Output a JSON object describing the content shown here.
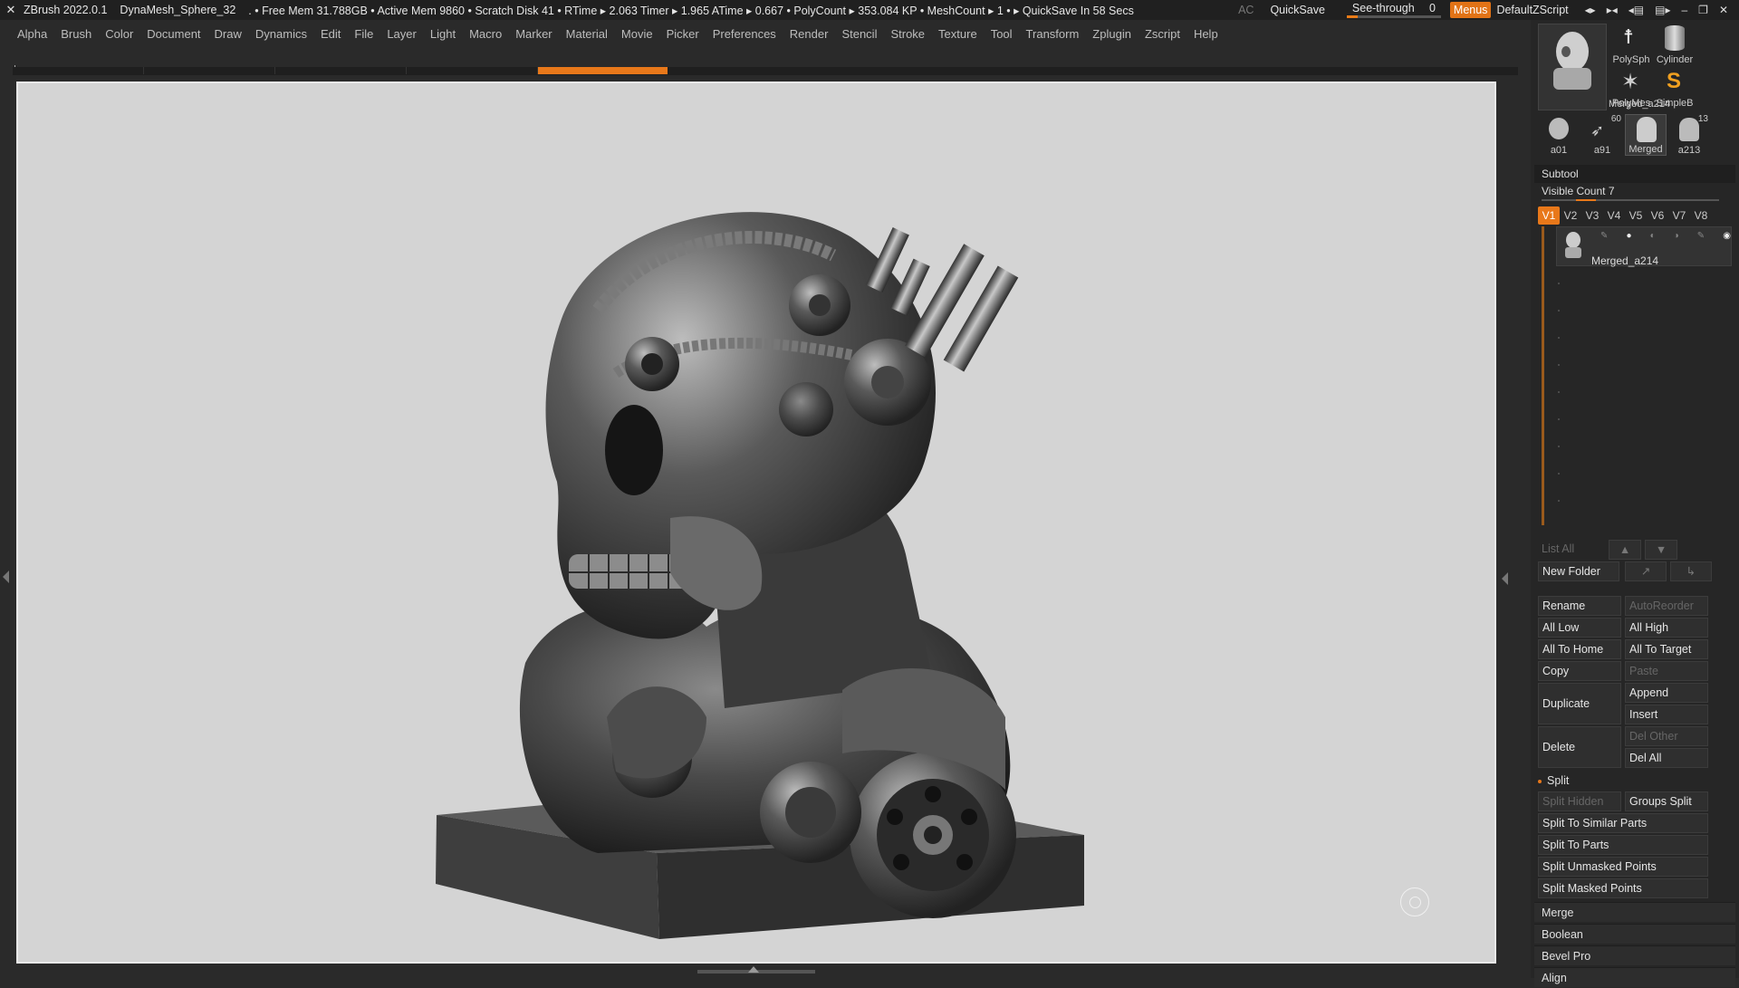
{
  "title_bar": {
    "app_name": "ZBrush 2022.0.1",
    "document": "DynaMesh_Sphere_32",
    "stats": ". • Free Mem 31.788GB • Active Mem 9860 • Scratch Disk 41 • RTime ▸ 2.063 Timer ▸ 1.965 ATime ▸ 0.667 • PolyCount ▸ 353.084 KP • MeshCount ▸ 1 • ▸ QuickSave In 58 Secs",
    "ac_label": "AC",
    "quicksave_label": "QuickSave",
    "see_through_label": "See-through",
    "see_through_value": "0",
    "menus_label": "Menus",
    "default_zscript_label": "DefaultZScript"
  },
  "menu_bar": {
    "items": [
      "Alpha",
      "Brush",
      "Color",
      "Document",
      "Draw",
      "Dynamics",
      "Edit",
      "File",
      "Layer",
      "Light",
      "Macro",
      "Marker",
      "Material",
      "Movie",
      "Picker",
      "Preferences",
      "Render",
      "Stencil",
      "Stroke",
      "Texture",
      "Tool",
      "Transform",
      "Zplugin",
      "Zscript",
      "Help"
    ]
  },
  "tool_palette": {
    "current_tool_label": "Merged_a214",
    "tools": [
      {
        "label": "PolySph",
        "icon": "polysphere-icon"
      },
      {
        "label": "Cylinder",
        "icon": "cylinder-icon"
      },
      {
        "label": "PolyMes",
        "icon": "polymesh-star-icon"
      },
      {
        "label": "SimpleB",
        "icon": "simplebrush-icon"
      },
      {
        "label": "a01",
        "icon": "skull-thumbnail-icon"
      },
      {
        "label": "a91",
        "icon": "arm-thumbnail-icon",
        "badge": "60"
      },
      {
        "label": "Merged",
        "icon": "bust-thumbnail-icon"
      },
      {
        "label": "a213",
        "icon": "bust-thumbnail-icon",
        "badge": "13"
      }
    ]
  },
  "subtool": {
    "header": "Subtool",
    "visible_count_label": "Visible Count 7",
    "visible_count": 7,
    "visibility_sets": [
      "V1",
      "V2",
      "V3",
      "V4",
      "V5",
      "V6",
      "V7",
      "V8"
    ],
    "active_set": "V1",
    "items": [
      {
        "name": "Merged_a214"
      }
    ],
    "list_all_label": "List All",
    "new_folder_label": "New Folder",
    "buttons": {
      "rename": "Rename",
      "autoreorder": "AutoReorder",
      "all_low": "All Low",
      "all_high": "All High",
      "all_to_home": "All To Home",
      "all_to_target": "All To Target",
      "copy": "Copy",
      "paste": "Paste",
      "duplicate": "Duplicate",
      "append": "Append",
      "insert": "Insert",
      "delete": "Delete",
      "del_other": "Del Other",
      "del_all": "Del All"
    },
    "split": {
      "header": "Split",
      "split_hidden": "Split Hidden",
      "groups_split": "Groups Split",
      "split_to_similar_parts": "Split To Similar Parts",
      "split_to_parts": "Split To Parts",
      "split_unmasked_points": "Split Unmasked Points",
      "split_masked_points": "Split Masked Points"
    },
    "sections": [
      "Merge",
      "Boolean",
      "Bevel Pro",
      "Align"
    ]
  },
  "colors": {
    "accent": "#e8781a",
    "viewport_bg": "#d4d4d4",
    "ui_bg": "#2a2a2a"
  }
}
